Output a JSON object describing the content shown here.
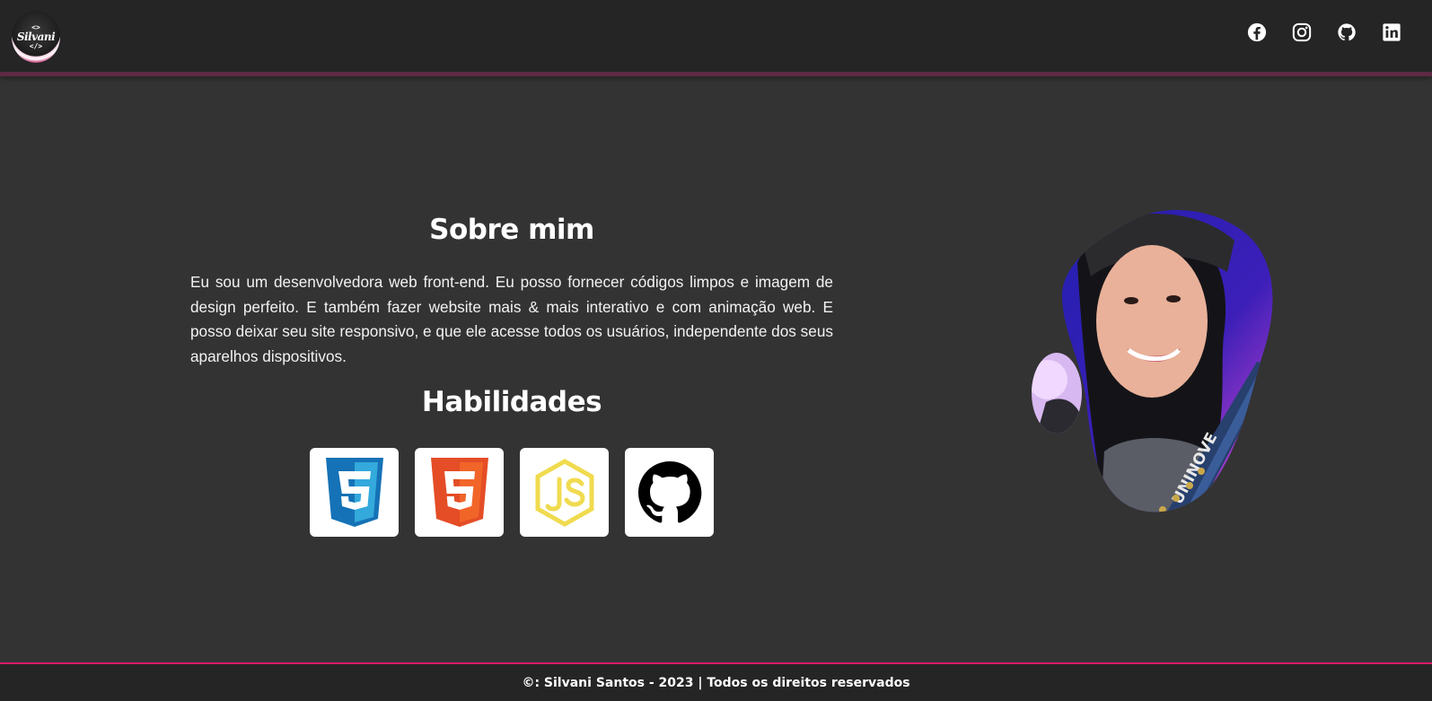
{
  "header": {
    "logo": {
      "brackets_top": "<>",
      "name": "Silvani",
      "brackets_bottom": "</>"
    },
    "social": [
      {
        "icon": "facebook-icon"
      },
      {
        "icon": "instagram-icon"
      },
      {
        "icon": "github-icon"
      },
      {
        "icon": "linkedin-icon"
      }
    ]
  },
  "about": {
    "title": "Sobre mim",
    "text": "Eu sou um desenvolvedora web front-end. Eu posso fornecer códigos limpos e imagem de design perfeito. E também fazer website mais & mais interativo e com animação web. E posso deixar seu site responsivo, e que ele acesse todos os usuários, independente dos seus aparelhos dispositivos."
  },
  "skills": {
    "title": "Habilidades",
    "items": [
      {
        "icon": "css3-icon",
        "color": "#1572b6"
      },
      {
        "icon": "html5-icon",
        "color": "#e44d26"
      },
      {
        "icon": "nodejs-icon",
        "color": "#f0db4f"
      },
      {
        "icon": "github-icon",
        "color": "#000000"
      }
    ]
  },
  "photo": {
    "badge_text": "UNINOVE"
  },
  "footer": {
    "text": "©: Silvani Santos - 2023 | Todos os direitos reservados"
  },
  "colors": {
    "background": "#333333",
    "header": "#252525",
    "accent": "#d81b6a"
  }
}
